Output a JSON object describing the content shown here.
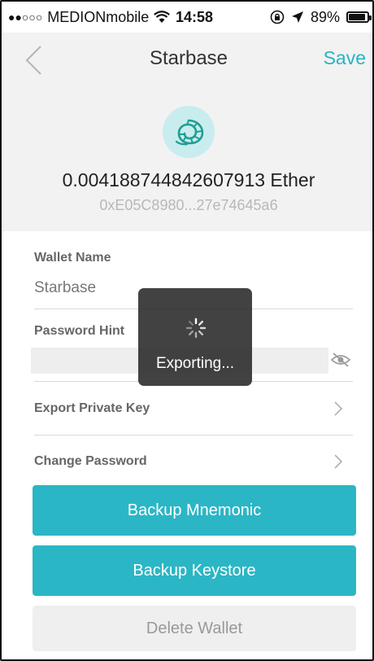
{
  "status_bar": {
    "signal_dots": "●●○○○",
    "carrier": "MEDIONmobile",
    "time": "14:58",
    "battery_text": "89%",
    "battery_level": 0.89
  },
  "nav": {
    "back_icon": "chevron-left-icon",
    "title": "Starbase",
    "save_label": "Save"
  },
  "wallet": {
    "icon": "nautilus-shell-icon",
    "balance": "0.004188744842607913 Ether",
    "address": "0xE05C8980...27e74645a6"
  },
  "form": {
    "wallet_name_label": "Wallet Name",
    "wallet_name_value": "Starbase",
    "password_hint_label": "Password Hint",
    "password_hint_value": "",
    "eye_icon": "eye-hidden-icon"
  },
  "rows": {
    "export_private_key": "Export Private Key",
    "change_password": "Change Password"
  },
  "buttons": {
    "backup_mnemonic": "Backup Mnemonic",
    "backup_keystore": "Backup Keystore",
    "delete_wallet": "Delete Wallet"
  },
  "overlay": {
    "text": "Exporting..."
  },
  "colors": {
    "accent": "#2bb6c5",
    "header_bg": "#f2f2f2",
    "avatar_bg": "#c9ecef",
    "muted_button_bg": "#efefef"
  }
}
